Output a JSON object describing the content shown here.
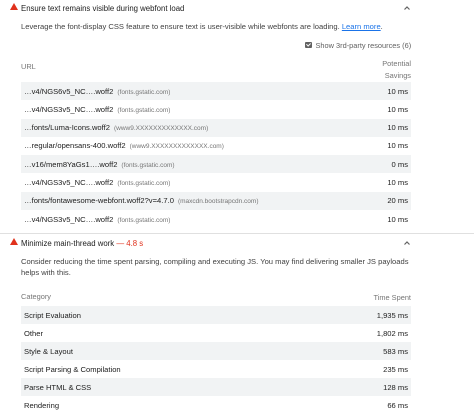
{
  "audit1": {
    "title": "Ensure text remains visible during webfont load",
    "description": "Leverage the font-display CSS feature to ensure text is user-visible while webfonts are loading.",
    "learn_more": "Learn more",
    "description_end": ".",
    "toggle_label": "Show 3rd-party resources (6)",
    "table": {
      "col_url": "URL",
      "col_savings_line1": "Potential",
      "col_savings_line2": "Savings",
      "rows": [
        {
          "url": "…v4/NGS6v5_NC….woff2",
          "host": "(fonts.gstatic.com)",
          "value": "10 ms"
        },
        {
          "url": "…v4/NGS3v5_NC….woff2",
          "host": "(fonts.gstatic.com)",
          "value": "10 ms"
        },
        {
          "url": "…fonts/Luma-Icons.woff2",
          "host": "(www9.XXXXXXXXXXXXX.com)",
          "value": "10 ms"
        },
        {
          "url": "…regular/opensans-400.woff2",
          "host": "(www9.XXXXXXXXXXXXX.com)",
          "value": "10 ms"
        },
        {
          "url": "…v16/mem8YaGs1….woff2",
          "host": "(fonts.gstatic.com)",
          "value": "0 ms"
        },
        {
          "url": "…v4/NGS3v5_NC….woff2",
          "host": "(fonts.gstatic.com)",
          "value": "10 ms"
        },
        {
          "url": "…fonts/fontawesome-webfont.woff2?v=4.7.0",
          "host": "(maxcdn.bootstrapcdn.com)",
          "value": "20 ms"
        },
        {
          "url": "…v4/NGS3v5_NC….woff2",
          "host": "(fonts.gstatic.com)",
          "value": "10 ms"
        }
      ]
    }
  },
  "audit2": {
    "title": "Minimize main-thread work",
    "separator": " — ",
    "display_value": "4.8 s",
    "description": "Consider reducing the time spent parsing, compiling and executing JS. You may find delivering smaller JS payloads helps with this.",
    "table": {
      "col_category": "Category",
      "col_time": "Time Spent",
      "rows": [
        {
          "category": "Script Evaluation",
          "value": "1,935 ms"
        },
        {
          "category": "Other",
          "value": "1,802 ms"
        },
        {
          "category": "Style & Layout",
          "value": "583 ms"
        },
        {
          "category": "Script Parsing & Compilation",
          "value": "235 ms"
        },
        {
          "category": "Parse HTML & CSS",
          "value": "128 ms"
        },
        {
          "category": "Rendering",
          "value": "66 ms"
        }
      ]
    }
  },
  "colors": {
    "fail": "#e0311c",
    "link": "#1a73e8",
    "row_shade": "#f1f3f4"
  },
  "icons": {
    "collapse": "chevron-up-icon",
    "status": "warning-triangle-icon",
    "toggle": "checkbox-checked-icon"
  }
}
